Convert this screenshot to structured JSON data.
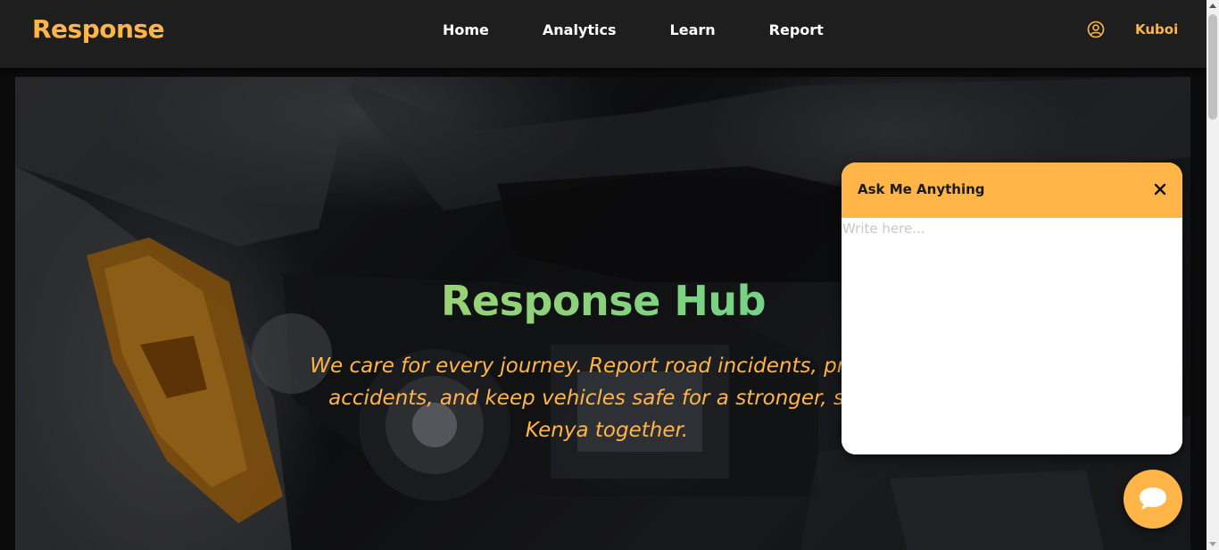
{
  "brand": "Response",
  "nav": {
    "links": [
      "Home",
      "Analytics",
      "Learn",
      "Report"
    ]
  },
  "user": {
    "icon": "user-circle-icon",
    "name": "Kuboi"
  },
  "hero": {
    "title": "Response Hub",
    "subtitle": "We care for every journey. Report road incidents, prevent accidents, and keep vehicles safe for a stronger, safer Kenya together."
  },
  "chat": {
    "title": "Ask Me Anything",
    "close_icon": "close-icon",
    "placeholder": "Write here...",
    "fab_icon": "chat-bubble-icon"
  },
  "colors": {
    "accent": "#ffb547",
    "navbar": "#1e1e1e",
    "title_gradient_start": "#c6d65e",
    "title_gradient_end": "#3fd69c"
  }
}
